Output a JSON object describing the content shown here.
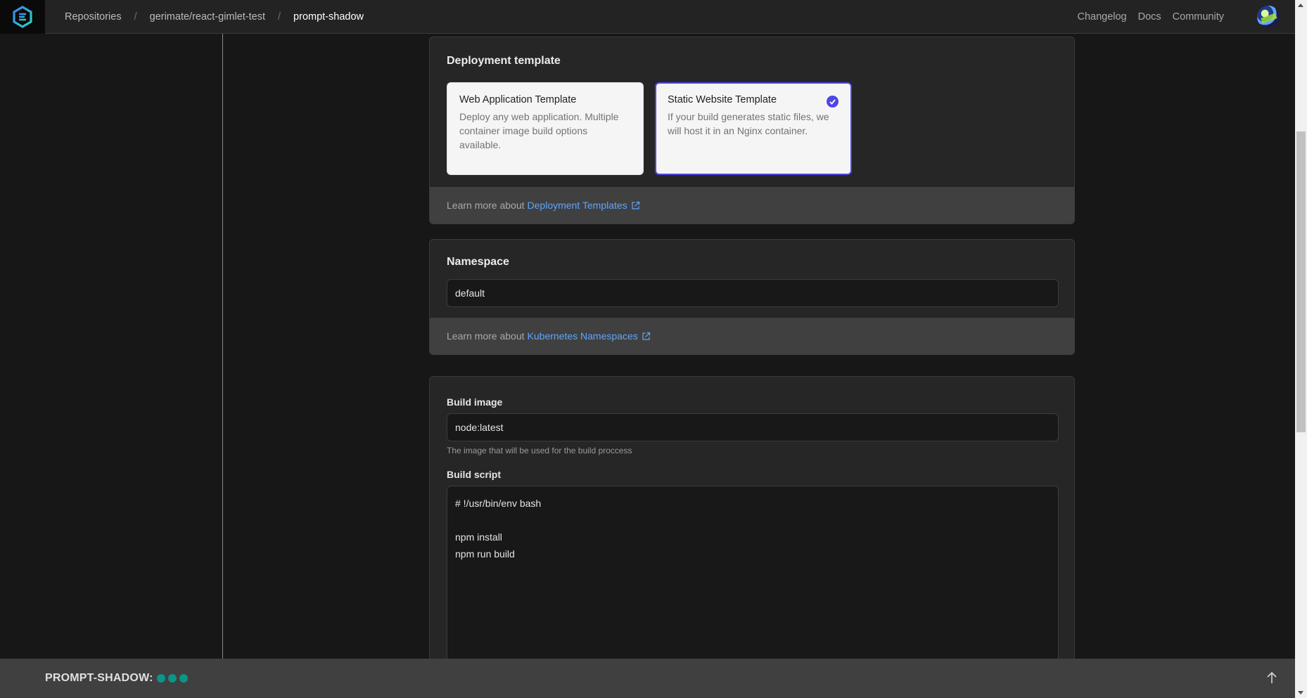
{
  "header": {
    "breadcrumbs": [
      {
        "label": "Repositories"
      },
      {
        "label": "gerimate/react-gimlet-test"
      },
      {
        "label": "prompt-shadow"
      }
    ],
    "separator": "/",
    "nav_links": [
      {
        "label": "Changelog"
      },
      {
        "label": "Docs"
      },
      {
        "label": "Community"
      }
    ],
    "logo_icon": "gimlet-hexagon-logo",
    "avatar_icon": "user-avatar"
  },
  "deployment_template": {
    "title": "Deployment template",
    "options": [
      {
        "title": "Web Application Template",
        "description": "Deploy any web application. Multiple container image build options available.",
        "selected": false
      },
      {
        "title": "Static Website Template",
        "description": "If your build generates static files, we will host it in an Nginx container.",
        "selected": true
      }
    ],
    "footer_prefix": "Learn more about",
    "footer_link": "Deployment Templates",
    "accent_color": "#4f46e5"
  },
  "namespace": {
    "title": "Namespace",
    "value": "default",
    "footer_prefix": "Learn more about",
    "footer_link": "Kubernetes Namespaces"
  },
  "build": {
    "image_label": "Build image",
    "image_value": "node:latest",
    "image_help": "The image that will be used for the build proccess",
    "script_label": "Build script",
    "script_value": "# !/usr/bin/env bash\n\nnpm install\nnpm run build"
  },
  "bottom_bar": {
    "title": "PROMPT-SHADOW:",
    "status_dots": 3,
    "status_color": "#0d9488",
    "scroll_top_icon": "arrow-up-icon"
  },
  "scrollbar": {
    "position_fraction": 0.28
  }
}
